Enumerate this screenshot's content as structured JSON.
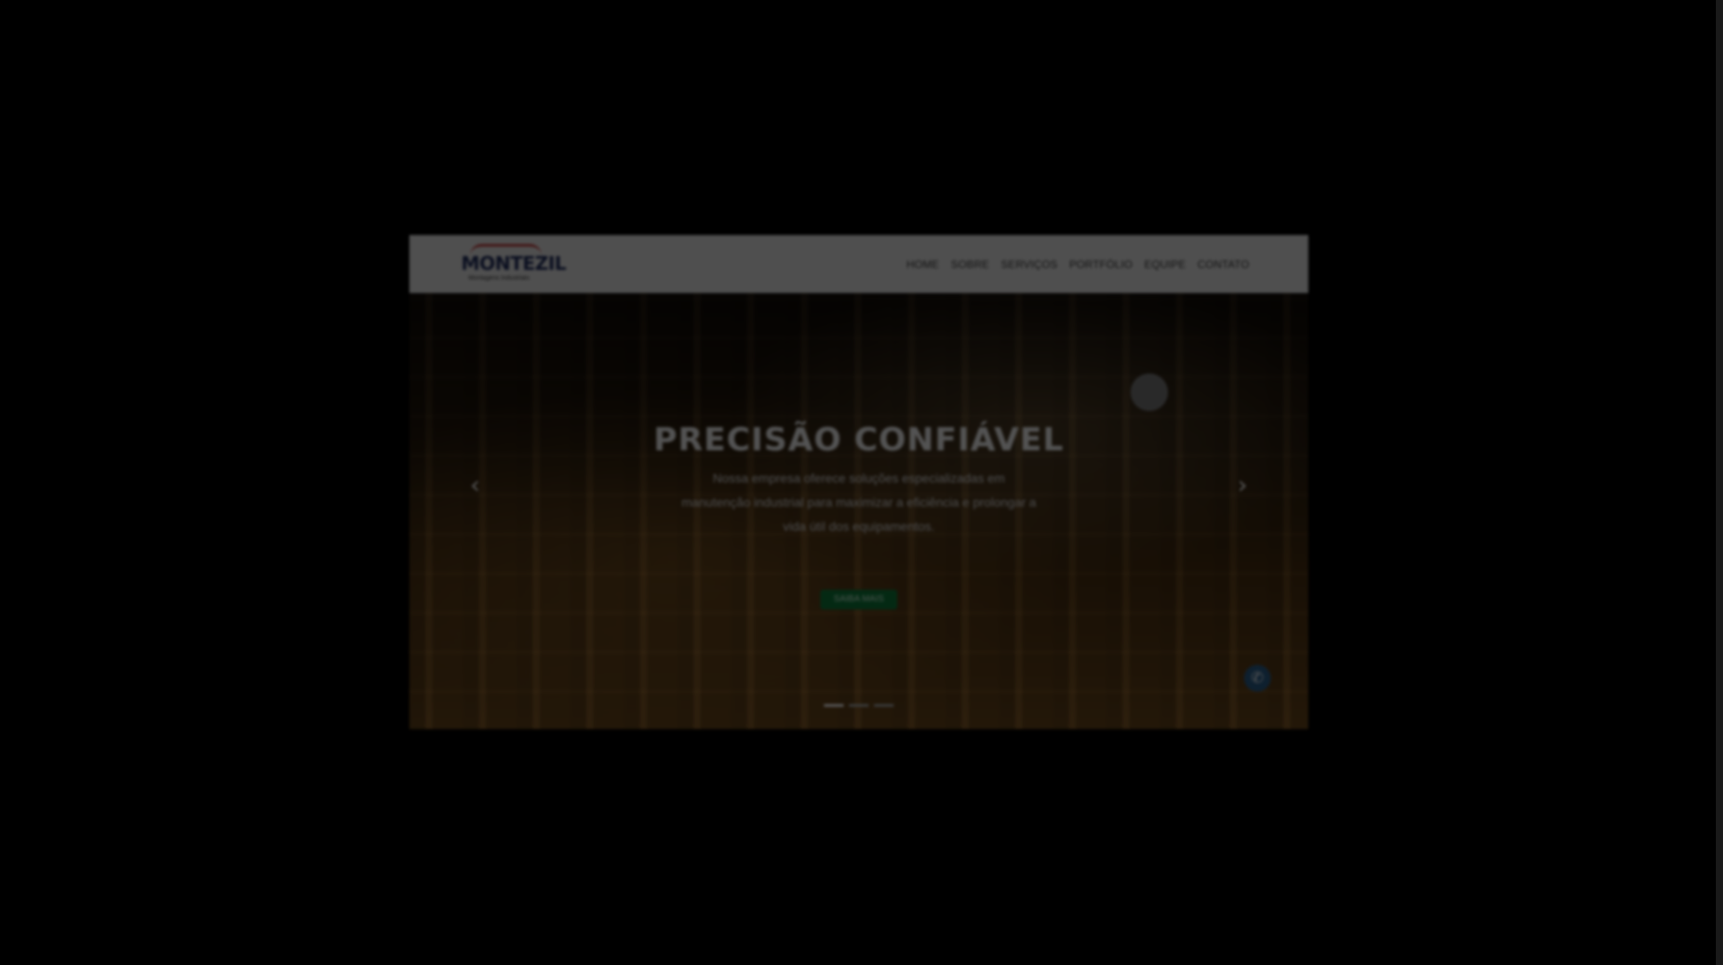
{
  "site": {
    "logo": {
      "name": "MONTEZIL",
      "tagline": "Montagens Industriais"
    },
    "nav": [
      "HOME",
      "SOBRE",
      "SERVIÇOS",
      "PORTFÓLIO",
      "EQUIPE",
      "CONTATO"
    ]
  },
  "hero": {
    "title": "PRECISÃO CONFIÁVEL",
    "text": "Nossa empresa oferece soluções especializadas em manutenção industrial para maximizar a eficiência e prolongar a vida útil dos equipamentos.",
    "button": "SAIBA MAIS",
    "prev_icon": "‹",
    "next_icon": "›",
    "slides": 3,
    "active_slide": 1
  },
  "floating": {
    "icon": "whatsapp-icon",
    "glyph": "✆"
  },
  "colors": {
    "overlay": "#000000",
    "navbar": "#e8e8e8",
    "logo": "#1e2b5c",
    "accent": "#0d7a3a"
  }
}
